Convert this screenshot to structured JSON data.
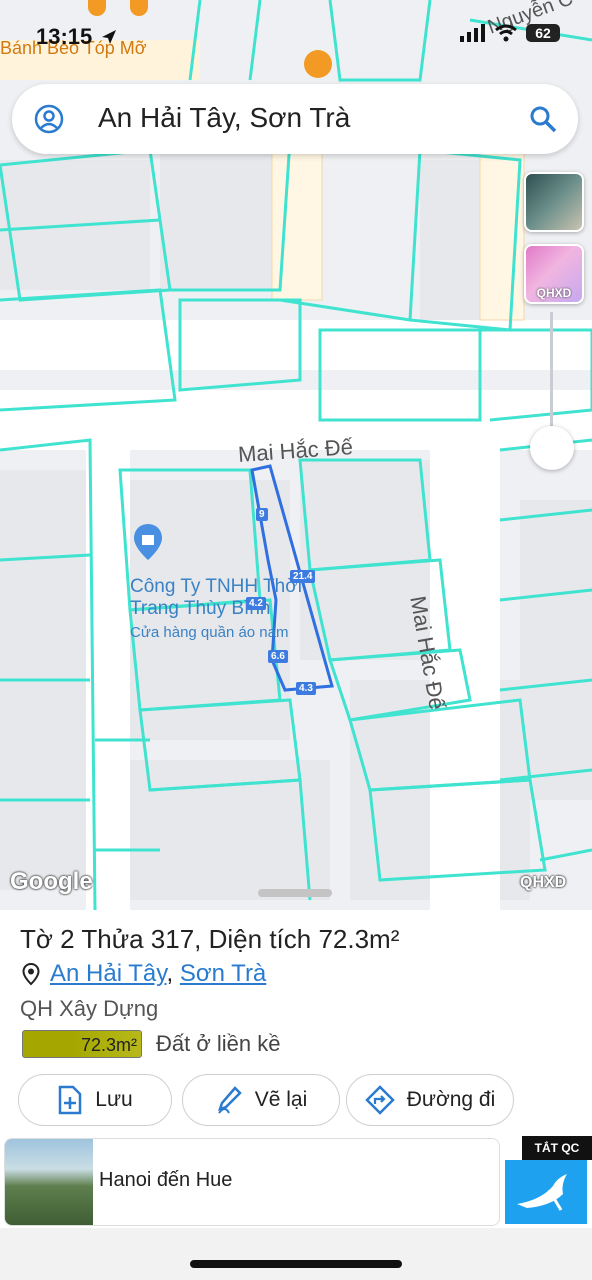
{
  "status_bar": {
    "time": "13:15",
    "battery": "62"
  },
  "search": {
    "query": "An Hải Tây, Sơn Trà"
  },
  "map": {
    "street_labels": [
      "Mai Hắc Đế",
      "Mai Hắc Đế"
    ],
    "top_labels": [
      "Bánh Bèo Tóp Mỡ",
      "Nguyễn C"
    ],
    "poi": {
      "name_line1": "Công Ty TNHH Thời",
      "name_line2": "Trang Thùy Bình",
      "category": "Cửa hàng quần áo nam"
    },
    "segment_labels": [
      "9",
      "21.4",
      "4.2",
      "6.6",
      "4.3"
    ],
    "layer_buttons": [
      "",
      "QHXD"
    ],
    "attribution": "Google",
    "qhxd_watermark": "QHXD"
  },
  "sheet": {
    "title": "Tờ 2 Thửa 317, Diện tích 72.3m²",
    "ward": "An Hải Tây",
    "separator": ",",
    "district": "Sơn Trà",
    "plan_label": "QH Xây Dựng",
    "area_badge": "72.3m²",
    "land_use": "Đất ở liền kề",
    "buttons": {
      "save": "Lưu",
      "redraw": "Vẽ lại",
      "directions": "Đường đi"
    }
  },
  "ad": {
    "text": "Hanoi đến Hue",
    "close_label": "TẮT QC"
  },
  "colors": {
    "parcel_lines": "#3fe3cf",
    "selected_parcel": "#2f6fe0",
    "accent": "#2a7bd0",
    "area_badge": "#a5a700"
  }
}
